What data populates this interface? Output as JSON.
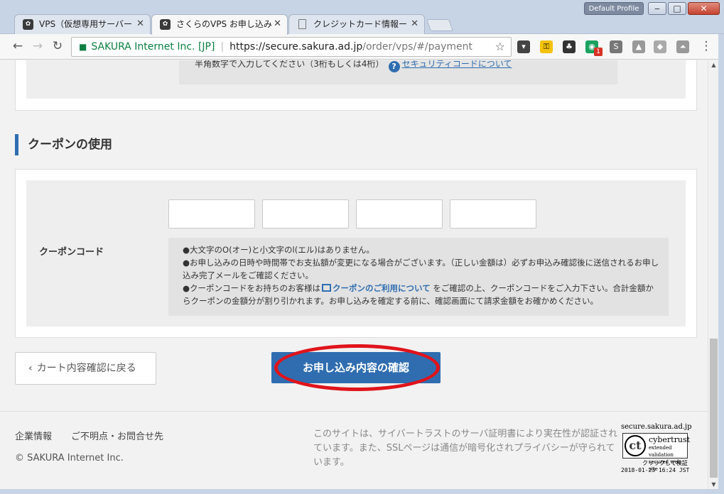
{
  "window": {
    "profile_label": "Default Profile",
    "minimize_glyph": "‒",
    "maximize_glyph": "□",
    "close_glyph": "✕"
  },
  "tabs": [
    {
      "label": "VPS（仮想専用サーバー",
      "icon": "sakura-favicon",
      "close": "✕"
    },
    {
      "label": "さくらのVPS お申し込み",
      "icon": "sakura-favicon",
      "close": "✕"
    },
    {
      "label": "クレジットカード情報ー",
      "icon": "document-icon",
      "close": "✕"
    }
  ],
  "toolbar": {
    "back_glyph": "←",
    "forward_glyph": "→",
    "reload_glyph": "↻",
    "secure_label": "SAKURA Internet Inc. [JP]",
    "url_scheme_host": "https://secure.sakura.ad.jp",
    "url_path": "/order/vps/#/payment",
    "star_glyph": "☆",
    "menu_glyph": "⋮",
    "badge_count": "1"
  },
  "security_code": {
    "hint": "半角数字で入力してください（3桁もしくは4桁）",
    "help_glyph": "?",
    "link": "セキュリティコードについて"
  },
  "coupon": {
    "section_title": "クーポンの使用",
    "label": "クーポンコード",
    "notes": {
      "line1": "●大文字のO(オー)と小文字のl(エル)はありません。",
      "line2": "●お申し込みの日時や時間帯でお支払額が変更になる場合がございます。（正しい金額は）必ずお申込み確認後に送信されるお申し込み完了メールをご確認ください。",
      "line3_pre": "●クーポンコードをお持ちのお客様は",
      "line3_link": "クーポンのご利用について",
      "line3_post": "をご確認の上、クーポンコードをご入力下さい。合計金額からクーポンの金額分が割り引かれます。お申し込みを確定する前に、確認画面にて請求金額をお確かめください。"
    }
  },
  "actions": {
    "back_label": "カート内容確認に戻る",
    "back_chevron": "‹",
    "confirm_label": "お申し込み内容の確認"
  },
  "footer": {
    "links": [
      "企業情報",
      "ご不明点・お問合せ先"
    ],
    "copyright": "© SAKURA Internet Inc.",
    "notice": "このサイトは、サイバートラストのサーバ証明書により実在性が認証されています。また、SSLページは通信が暗号化されプライバシーが守られています。",
    "seal": {
      "domain": "secure.sakura.ad.jp",
      "logo": "ct",
      "brand": "cybertrust",
      "line1": "extended validation",
      "line2": "secured web site",
      "click": "クリックして検証",
      "date": "2018-01-23 16:24 JST"
    }
  },
  "colors": {
    "accent": "#2f6db0",
    "highlight": "#e0141b",
    "secure_green": "#0b8043"
  }
}
